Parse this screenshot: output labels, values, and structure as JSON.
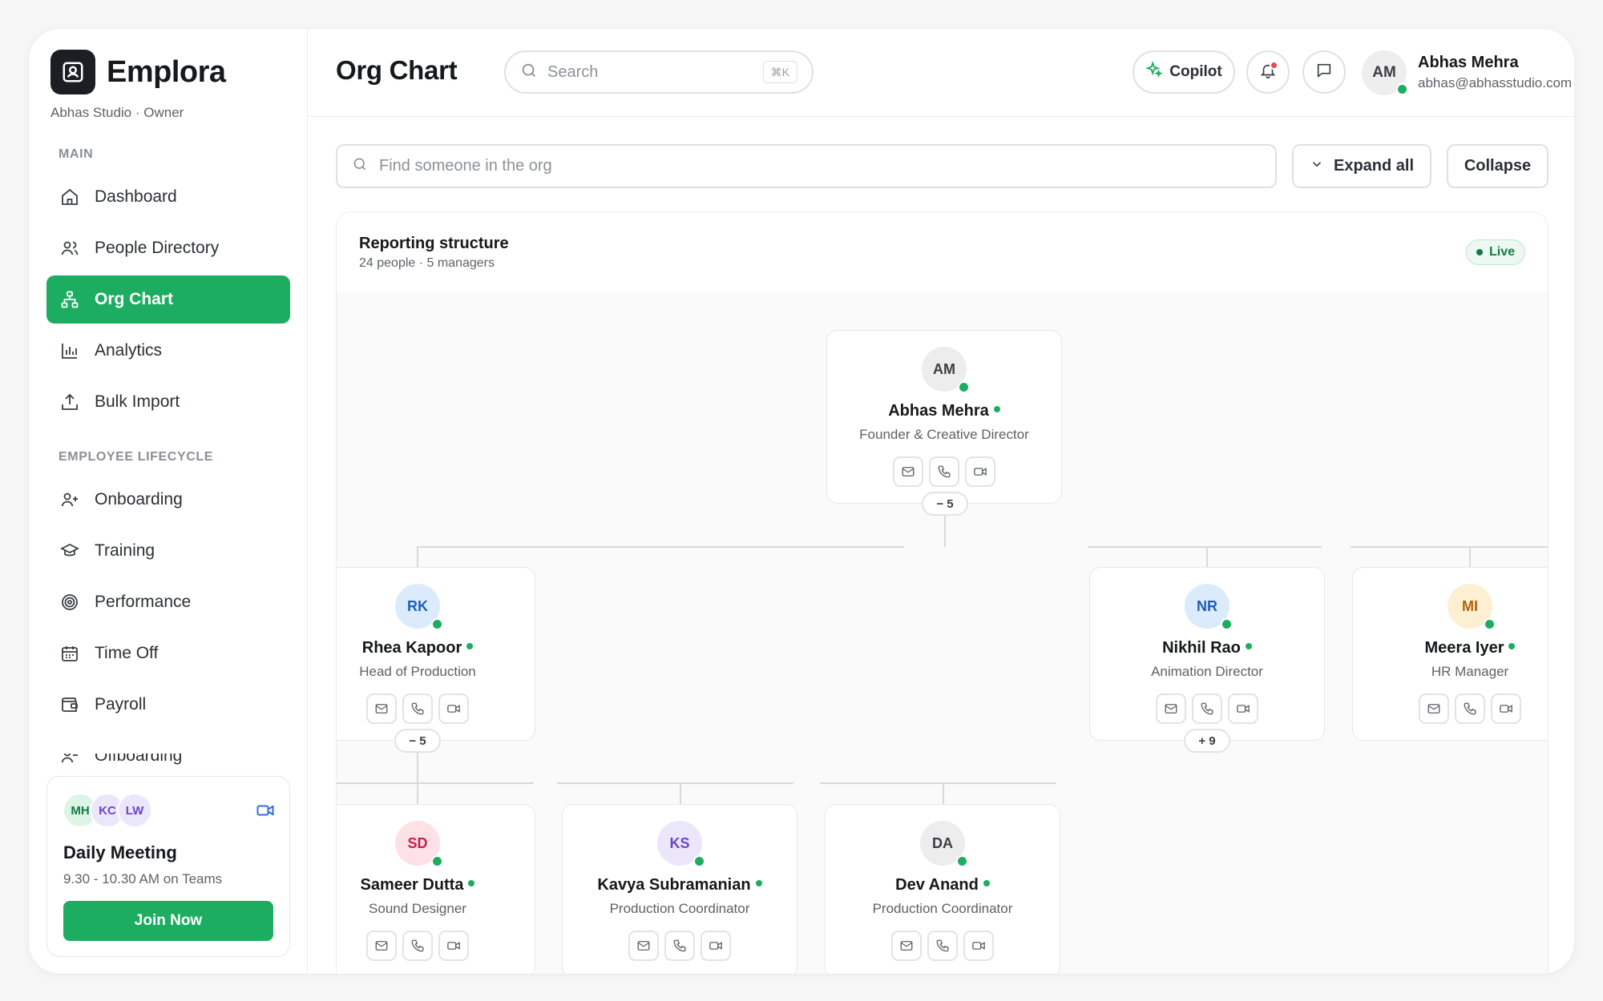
{
  "brand": {
    "name": "Emplora",
    "subtitle": "Abhas Studio · Owner"
  },
  "sidebar": {
    "main_label": "MAIN",
    "main_items": [
      {
        "label": "Dashboard",
        "icon": "home-icon"
      },
      {
        "label": "People Directory",
        "icon": "users-icon"
      },
      {
        "label": "Org Chart",
        "icon": "org-chart-icon",
        "active": true
      },
      {
        "label": "Analytics",
        "icon": "bar-chart-icon"
      },
      {
        "label": "Bulk Import",
        "icon": "upload-icon"
      }
    ],
    "lifecycle_label": "EMPLOYEE LIFECYCLE",
    "lifecycle_items": [
      {
        "label": "Onboarding",
        "icon": "user-plus-icon"
      },
      {
        "label": "Training",
        "icon": "graduation-cap-icon"
      },
      {
        "label": "Performance",
        "icon": "target-icon"
      },
      {
        "label": "Time Off",
        "icon": "calendar-icon"
      },
      {
        "label": "Payroll",
        "icon": "wallet-icon"
      },
      {
        "label": "Offboarding",
        "icon": "user-minus-icon"
      }
    ]
  },
  "meeting": {
    "avatars": [
      {
        "initials": "MH",
        "bg": "#dcf5e5",
        "fg": "#157a45"
      },
      {
        "initials": "KC",
        "bg": "#ece6fb",
        "fg": "#6a45c9"
      },
      {
        "initials": "LW",
        "bg": "#ece6fb",
        "fg": "#6a45c9"
      }
    ],
    "title": "Daily Meeting",
    "time": "9.30 - 10.30 AM on Teams",
    "join_label": "Join Now"
  },
  "header": {
    "title": "Org Chart",
    "search_placeholder": "Search",
    "search_shortcut": "⌘K",
    "copilot_label": "Copilot",
    "user": {
      "initials": "AM",
      "name": "Abhas Mehra",
      "email": "abhas@abhasstudio.com"
    }
  },
  "toolbar": {
    "find_placeholder": "Find someone in the org",
    "expand_label": "Expand all",
    "collapse_label": "Collapse"
  },
  "panel": {
    "title": "Reporting structure",
    "subtitle": "24 people · 5 managers",
    "live_label": "Live"
  },
  "org": {
    "root": {
      "initials": "AM",
      "name": "Abhas Mehra",
      "role": "Founder & Creative Director",
      "bg": "#ededed",
      "fg": "#3a3e44",
      "toggle": "− 5"
    },
    "level1": [
      {
        "initials": "RK",
        "name": "Rhea Kapoor",
        "role": "Head of Production",
        "bg": "#dcebfc",
        "fg": "#1d5fb8",
        "toggle": "− 5"
      },
      {
        "initials": "NR",
        "name": "Nikhil Rao",
        "role": "Animation Director",
        "bg": "#dcebfc",
        "fg": "#1d5fb8",
        "toggle": "+ 9"
      },
      {
        "initials": "MI",
        "name": "Meera Iyer",
        "role": "HR Manager",
        "bg": "#fdf0d2",
        "fg": "#b2620b"
      }
    ],
    "level2": [
      {
        "initials": "SD",
        "name": "Sameer Dutta",
        "role": "Sound Designer",
        "bg": "#fde1e6",
        "fg": "#c4204a"
      },
      {
        "initials": "KS",
        "name": "Kavya Subramanian",
        "role": "Production Coordinator",
        "bg": "#ece6fb",
        "fg": "#6a45c9"
      },
      {
        "initials": "DA",
        "name": "Dev Anand",
        "role": "Production Coordinator",
        "bg": "#ededed",
        "fg": "#3a3e44"
      }
    ]
  },
  "colors": {
    "accent": "#1cad60",
    "notification": "#e5484d"
  }
}
